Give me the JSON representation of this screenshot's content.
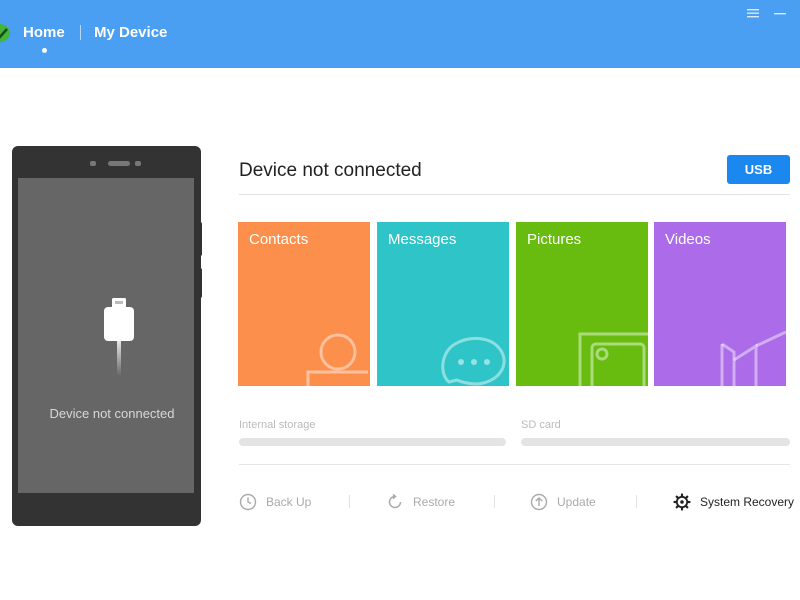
{
  "header": {
    "nav": [
      {
        "label": "Home",
        "active": true
      },
      {
        "label": "My Device",
        "active": false
      }
    ],
    "colors": {
      "background": "#4a9ff3",
      "text": "#ffffff"
    },
    "window_controls": [
      "menu-icon",
      "minimize-icon"
    ]
  },
  "phone": {
    "status_text": "Device not connected",
    "icon": "usb-cable-icon"
  },
  "main": {
    "status_title": "Device not connected",
    "connect_button": "USB",
    "tiles": [
      {
        "label": "Contacts",
        "color": "#fd8f4d",
        "icon": "contact-icon"
      },
      {
        "label": "Messages",
        "color": "#2fc5c8",
        "icon": "chat-bubble-icon"
      },
      {
        "label": "Pictures",
        "color": "#67bc0f",
        "icon": "picture-icon"
      },
      {
        "label": "Videos",
        "color": "#ac6be8",
        "icon": "video-camera-icon"
      }
    ],
    "storage": [
      {
        "label": "Internal storage",
        "used_fraction": 0
      },
      {
        "label": "SD card",
        "used_fraction": 0
      }
    ],
    "actions": [
      {
        "label": "Back Up",
        "icon": "clock-icon",
        "enabled": false
      },
      {
        "label": "Restore",
        "icon": "restore-icon",
        "enabled": false
      },
      {
        "label": "Update",
        "icon": "upload-icon",
        "enabled": false
      },
      {
        "label": "System Recovery",
        "icon": "gear-icon",
        "enabled": true
      }
    ],
    "accent_color": "#1a88ee"
  }
}
